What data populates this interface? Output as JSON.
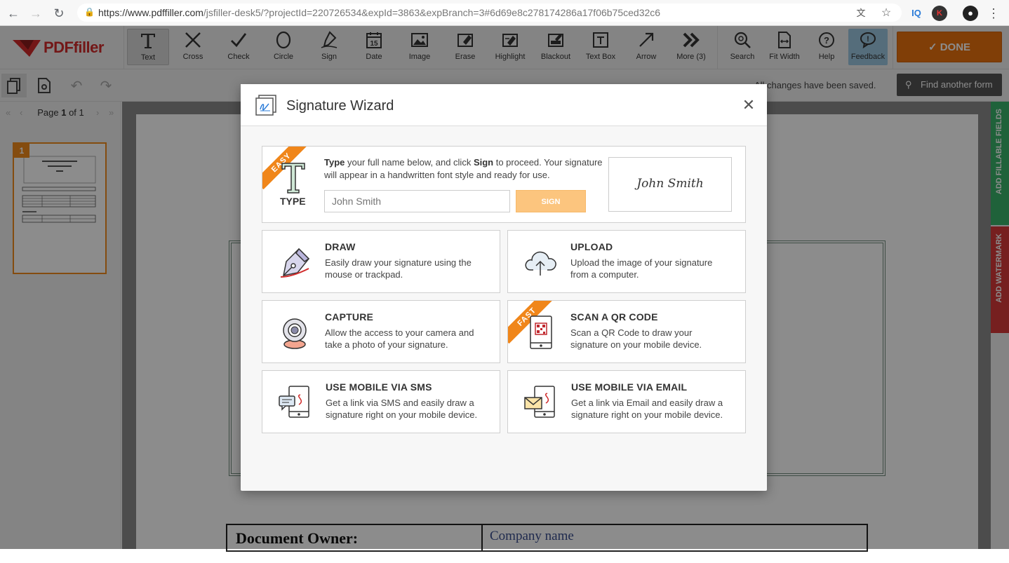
{
  "browser": {
    "url_host": "https://www.pdffiller.com",
    "url_path": "/jsfiller-desk5/?projectId=220726534&expId=3863&expBranch=3#6d69e8c278174286a17f06b75ced32c6",
    "ext_iq": "IQ",
    "ext_k": "K"
  },
  "app": {
    "logo_text": "PDFfiller",
    "tools": [
      {
        "label": "Text",
        "icon": "text-icon"
      },
      {
        "label": "Cross",
        "icon": "cross-icon"
      },
      {
        "label": "Check",
        "icon": "check-icon"
      },
      {
        "label": "Circle",
        "icon": "circle-icon"
      },
      {
        "label": "Sign",
        "icon": "sign-pen-icon"
      },
      {
        "label": "Date",
        "icon": "calendar-icon"
      },
      {
        "label": "Image",
        "icon": "image-icon"
      },
      {
        "label": "Erase",
        "icon": "eraser-icon"
      },
      {
        "label": "Highlight",
        "icon": "highlight-icon"
      },
      {
        "label": "Blackout",
        "icon": "blackout-icon"
      },
      {
        "label": "Text Box",
        "icon": "textbox-icon"
      },
      {
        "label": "Arrow",
        "icon": "arrow-icon"
      },
      {
        "label": "More (3)",
        "icon": "more-icon"
      },
      {
        "label": "Search",
        "icon": "search-icon"
      },
      {
        "label": "Fit Width",
        "icon": "fit-width-icon"
      },
      {
        "label": "Help",
        "icon": "help-icon"
      },
      {
        "label": "Feedback",
        "icon": "feedback-icon"
      }
    ],
    "date_icon_number": "15",
    "done_label": "DONE",
    "saved_text": "All changes have been saved.",
    "find_form_label": "Find another form",
    "page_prefix": "Page",
    "page_current": "1",
    "page_of": "of 1",
    "thumb_number": "1",
    "right_tabs": {
      "fillable": "ADD FILLABLE FIELDS",
      "watermark": "ADD WATERMARK"
    },
    "document": {
      "owner_label": "Document Owner:",
      "owner_value": "Company name"
    }
  },
  "modal": {
    "title": "Signature Wizard",
    "type_card": {
      "ribbon": "EASY",
      "label": "TYPE",
      "desc_bold1": "Type",
      "desc_part1": " your full name below, and click ",
      "desc_bold2": "Sign",
      "desc_part2": " to proceed. Your signature will appear in a handwritten font style and ready for use.",
      "input_placeholder": "John Smith",
      "sign_label": "SIGN",
      "preview_text": "John Smith"
    },
    "options": [
      {
        "title": "DRAW",
        "desc": "Easily draw your signature using the mouse or trackpad.",
        "icon": "pen-nib-icon"
      },
      {
        "title": "UPLOAD",
        "desc": "Upload the image of your signature from a computer.",
        "icon": "cloud-upload-icon"
      },
      {
        "title": "CAPTURE",
        "desc": "Allow the access to your camera and take a photo of your signature.",
        "icon": "webcam-icon"
      },
      {
        "title": "SCAN A QR CODE",
        "desc": "Scan a QR Code to draw your signature on your mobile device.",
        "icon": "qr-phone-icon",
        "ribbon": "FAST"
      },
      {
        "title": "USE MOBILE VIA SMS",
        "desc": "Get a link via SMS and easily draw a signature right on your mobile device.",
        "icon": "sms-phone-icon"
      },
      {
        "title": "USE MOBILE VIA EMAIL",
        "desc": "Get a link via Email and easily draw a signature right on your mobile device.",
        "icon": "email-phone-icon"
      }
    ]
  }
}
